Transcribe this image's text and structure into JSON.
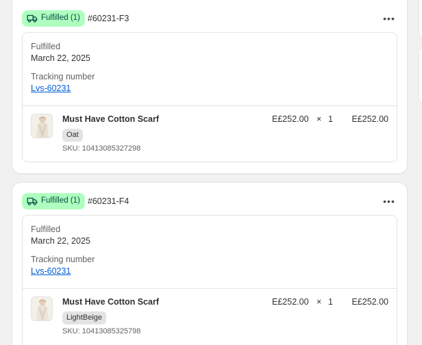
{
  "fulfillments": [
    {
      "badge_label": "Fulfilled (1)",
      "order_id": "#60231-F3",
      "status_label": "Fulfilled",
      "date": "March 22, 2025",
      "tracking_label": "Tracking number",
      "tracking_number": "Lvs-60231",
      "item": {
        "name": "Must Have Cotton Scarf",
        "variant": "Oat",
        "sku": "SKU: 10413085327298",
        "price": "E£252.00",
        "times": "×",
        "quantity": "1",
        "total": "E£252.00"
      }
    },
    {
      "badge_label": "Fulfilled (1)",
      "order_id": "#60231-F4",
      "status_label": "Fulfilled",
      "date": "March 22, 2025",
      "tracking_label": "Tracking number",
      "tracking_number": "Lvs-60231",
      "item": {
        "name": "Must Have Cotton Scarf",
        "variant": "LightBeige",
        "sku": "SKU: 10413085325798",
        "price": "E£252.00",
        "times": "×",
        "quantity": "1",
        "total": "E£252.00"
      }
    }
  ],
  "more_icon": "•••",
  "colors": {
    "badge_bg": "#affebf",
    "badge_text": "#014b40",
    "link": "#005bd3"
  }
}
